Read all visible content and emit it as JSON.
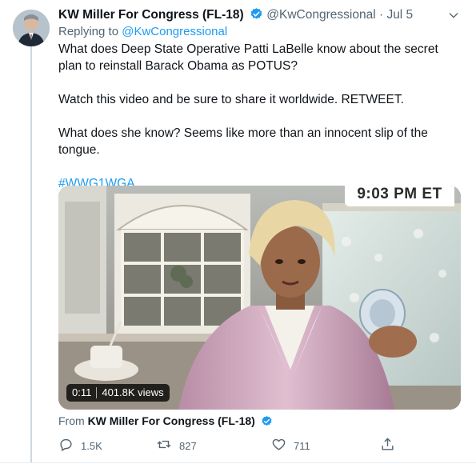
{
  "tweet": {
    "author_name": "KW Miller For Congress (FL-18)",
    "handle": "@KwCongressional",
    "separator": "·",
    "date": "Jul 5",
    "replying_prefix": "Replying to",
    "replying_handle": "@KwCongressional",
    "paragraphs": [
      "What does Deep State Operative Patti LaBelle know about the secret plan to reinstall Barack Obama as POTUS?",
      "Watch this video and be sure to share it worldwide. RETWEET.",
      "What does she know? Seems like more than an innocent slip of the tongue."
    ],
    "hashtag": "#WWG1WGA"
  },
  "media": {
    "timestamp_banner": "9:03 PM ET",
    "duration": "0:11",
    "views": "401.8K views"
  },
  "source": {
    "prefix": "From",
    "name": "KW Miller For Congress (FL-18)"
  },
  "actions": {
    "replies": "1.5K",
    "retweets": "827",
    "likes": "711"
  },
  "icons": {
    "verified": "verified-badge-icon",
    "more": "chevron-down-icon",
    "reply": "reply-icon",
    "retweet": "retweet-icon",
    "like": "heart-icon",
    "share": "share-icon"
  },
  "colors": {
    "link": "#1d9bf0",
    "secondary_text": "#536471",
    "primary_text": "#0f1419"
  }
}
